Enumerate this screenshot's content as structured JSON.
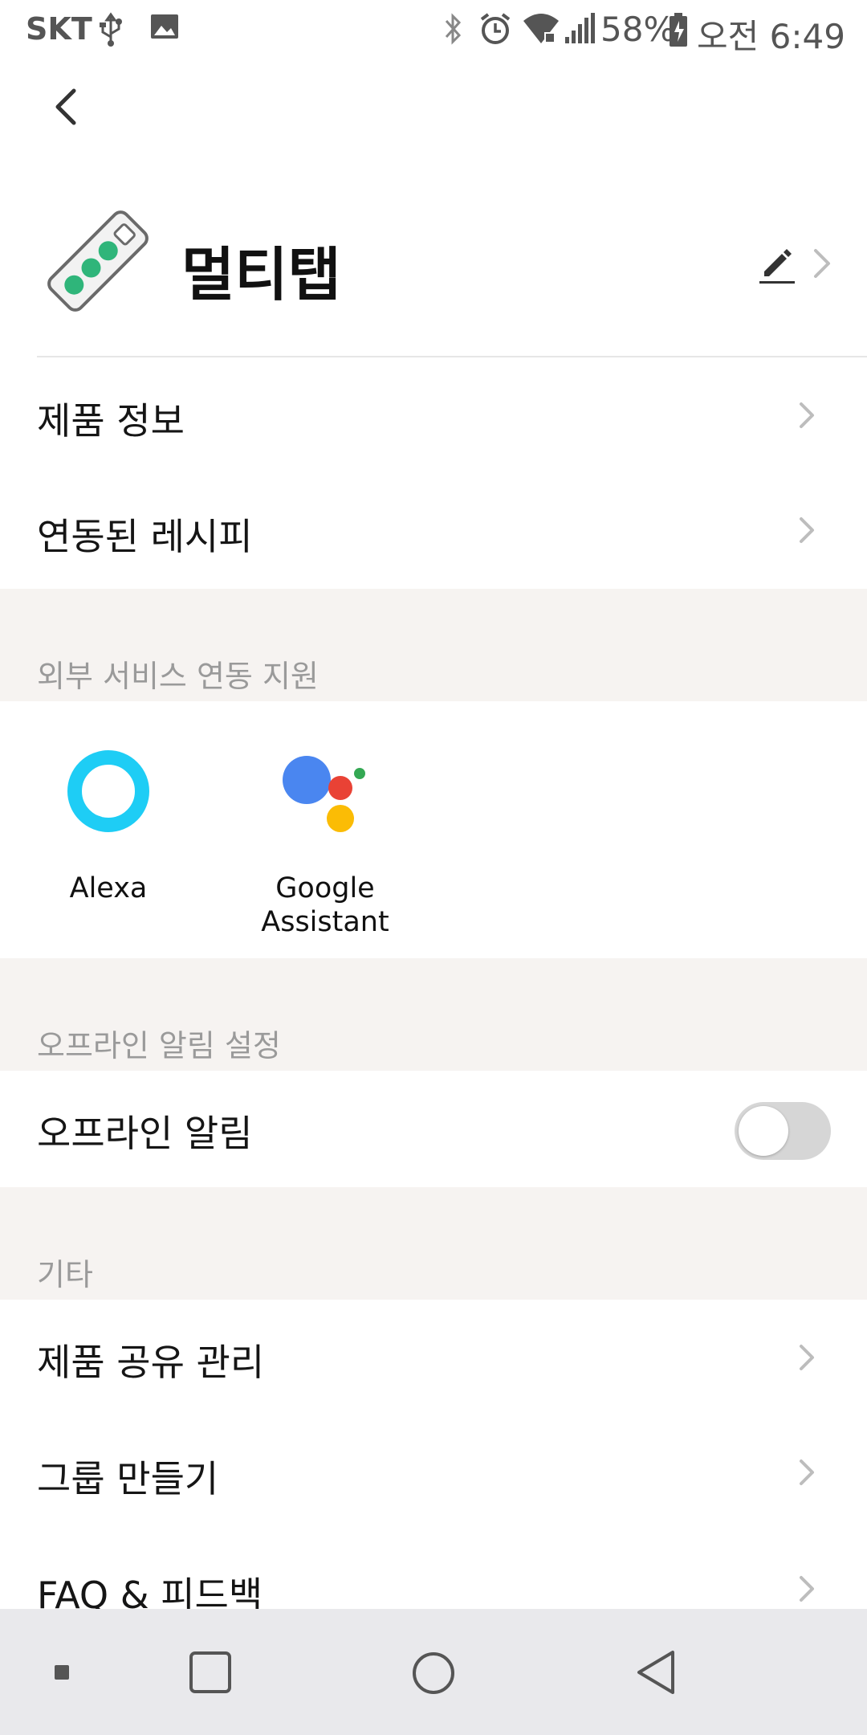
{
  "status_bar": {
    "carrier": "SKT",
    "battery": "58%",
    "time": "오전 6:49",
    "icons": [
      "usb-icon",
      "image-icon",
      "bluetooth-icon",
      "alarm-icon",
      "wifi-icon",
      "signal-icon",
      "battery-icon"
    ]
  },
  "header": {
    "device_name": "멀티탭",
    "device_icon": "power-strip-icon"
  },
  "menu_top": [
    {
      "label": "제품 정보"
    },
    {
      "label": "연동된 레시피"
    }
  ],
  "external_services": {
    "section_label": "외부 서비스 연동 지원",
    "items": [
      {
        "label_line1": "Alexa",
        "label_line2": ""
      },
      {
        "label_line1": "Google",
        "label_line2": "Assistant"
      }
    ]
  },
  "offline": {
    "section_label": "오프라인 알림 설정",
    "row_label": "오프라인 알림",
    "toggle_on": false
  },
  "other": {
    "section_label": "기타",
    "items": [
      {
        "label": "제품 공유 관리"
      },
      {
        "label": "그룹 만들기"
      },
      {
        "label": "FAQ & 피드백"
      }
    ]
  },
  "colors": {
    "section_bg": "#f6f3f1",
    "alexa": "#1ecdf5",
    "google_blue": "#4a86f0",
    "google_red": "#e94235",
    "google_yellow": "#fbbc05",
    "google_green": "#34a853",
    "toggle_off": "#d6d6d6"
  }
}
